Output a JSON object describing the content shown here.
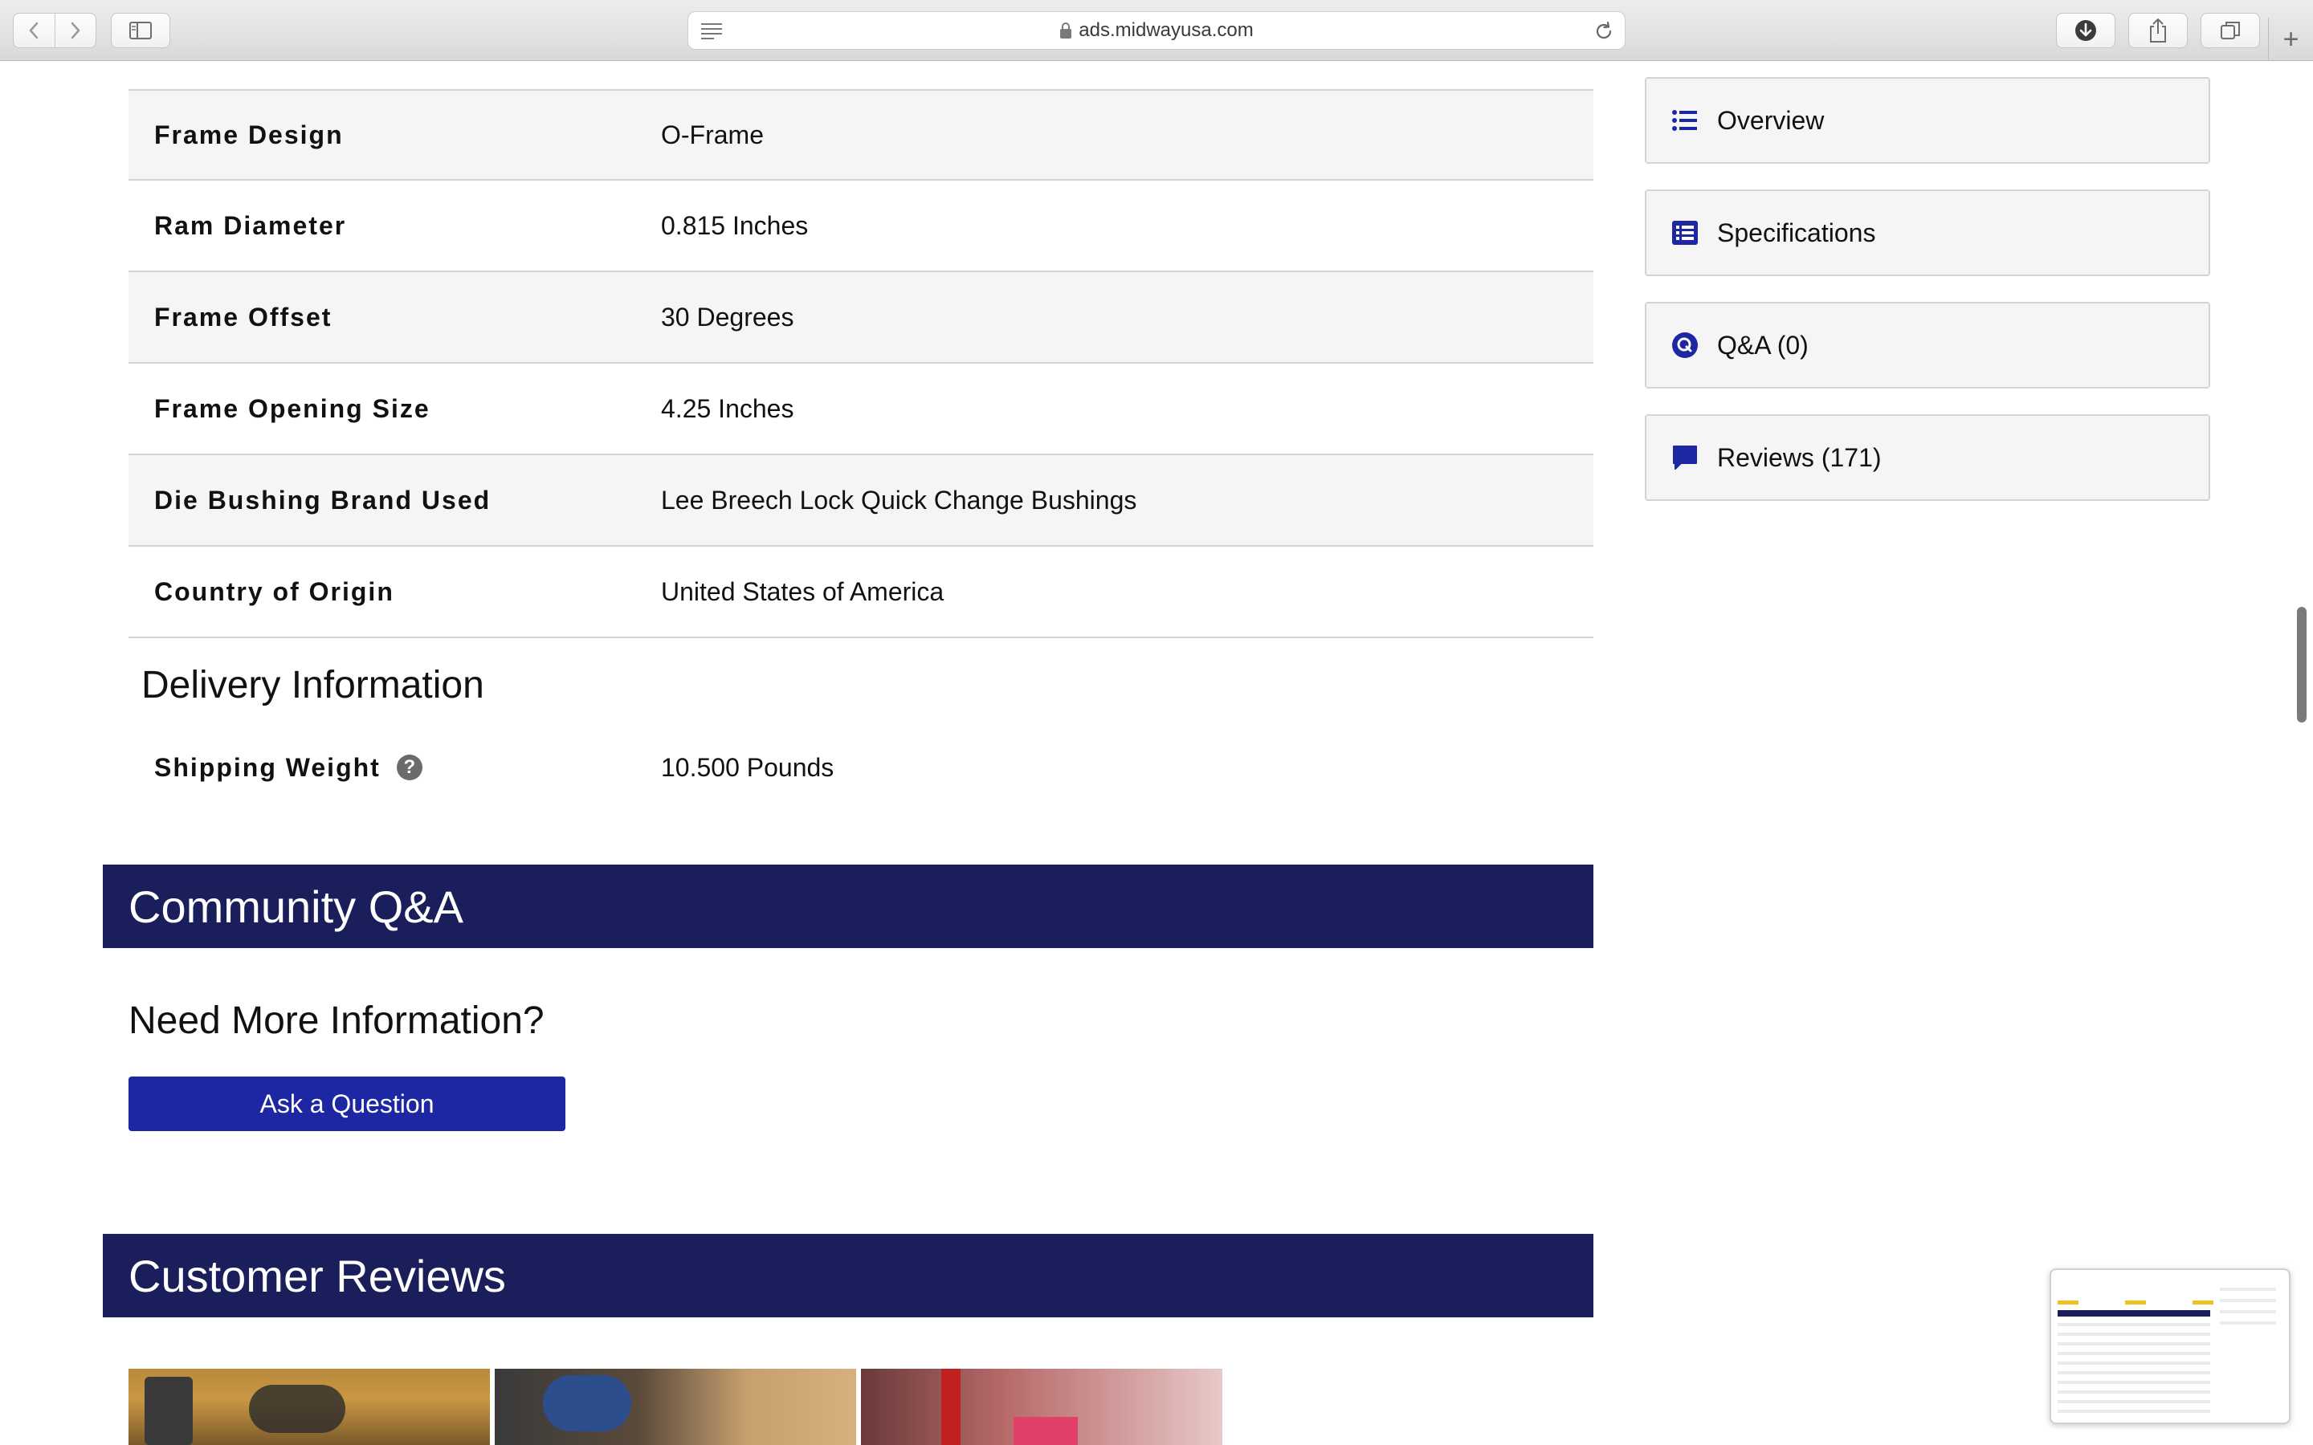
{
  "browser": {
    "url": "ads.midwayusa.com"
  },
  "specs": [
    {
      "label": "Frame Design",
      "value": "O-Frame"
    },
    {
      "label": "Ram Diameter",
      "value": "0.815 Inches"
    },
    {
      "label": "Frame Offset",
      "value": "30 Degrees"
    },
    {
      "label": "Frame Opening Size",
      "value": "4.25 Inches"
    },
    {
      "label": "Die Bushing Brand Used",
      "value": "Lee Breech Lock Quick Change Bushings"
    },
    {
      "label": "Country of Origin",
      "value": "United States of America"
    }
  ],
  "delivery": {
    "title": "Delivery Information",
    "shipping_label": "Shipping Weight",
    "shipping_value": "10.500 Pounds"
  },
  "community": {
    "title": "Community Q&A",
    "need_info": "Need More Information?",
    "ask_button": "Ask a Question"
  },
  "reviews": {
    "title": "Customer Reviews"
  },
  "sidebar": {
    "items": [
      {
        "label": "Overview",
        "icon": "list-icon"
      },
      {
        "label": "Specifications",
        "icon": "spec-list-icon"
      },
      {
        "label": "Q&A (0)",
        "icon": "q-circle-icon"
      },
      {
        "label": "Reviews (171)",
        "icon": "chat-bubble-icon"
      }
    ]
  },
  "colors": {
    "band": "#1a1f5c",
    "button": "#1d27a3",
    "icon_accent": "#1d27a3",
    "row_shade": "#f5f5f5"
  }
}
